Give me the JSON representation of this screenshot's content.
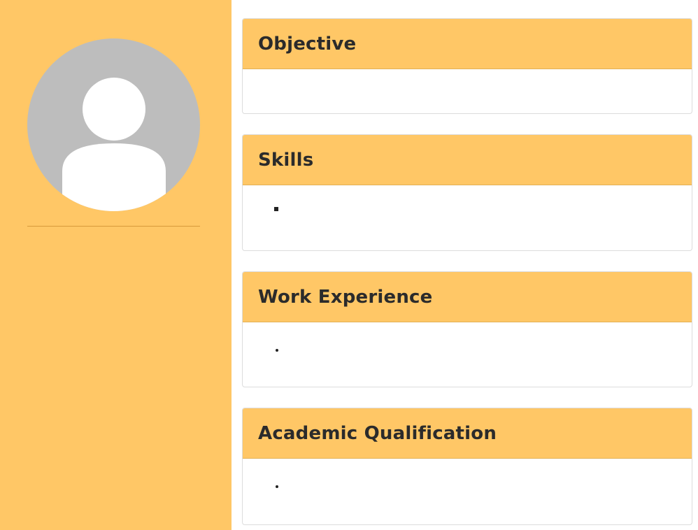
{
  "sidebar": {
    "avatar": "default-user-avatar"
  },
  "sections": {
    "objective": {
      "title": "Objective"
    },
    "skills": {
      "title": "Skills"
    },
    "work_experience": {
      "title": "Work Experience"
    },
    "academic_qualification": {
      "title": "Academic Qualification"
    }
  },
  "colors": {
    "accent": "#ffc766",
    "avatar_bg": "#bdbdbd"
  }
}
